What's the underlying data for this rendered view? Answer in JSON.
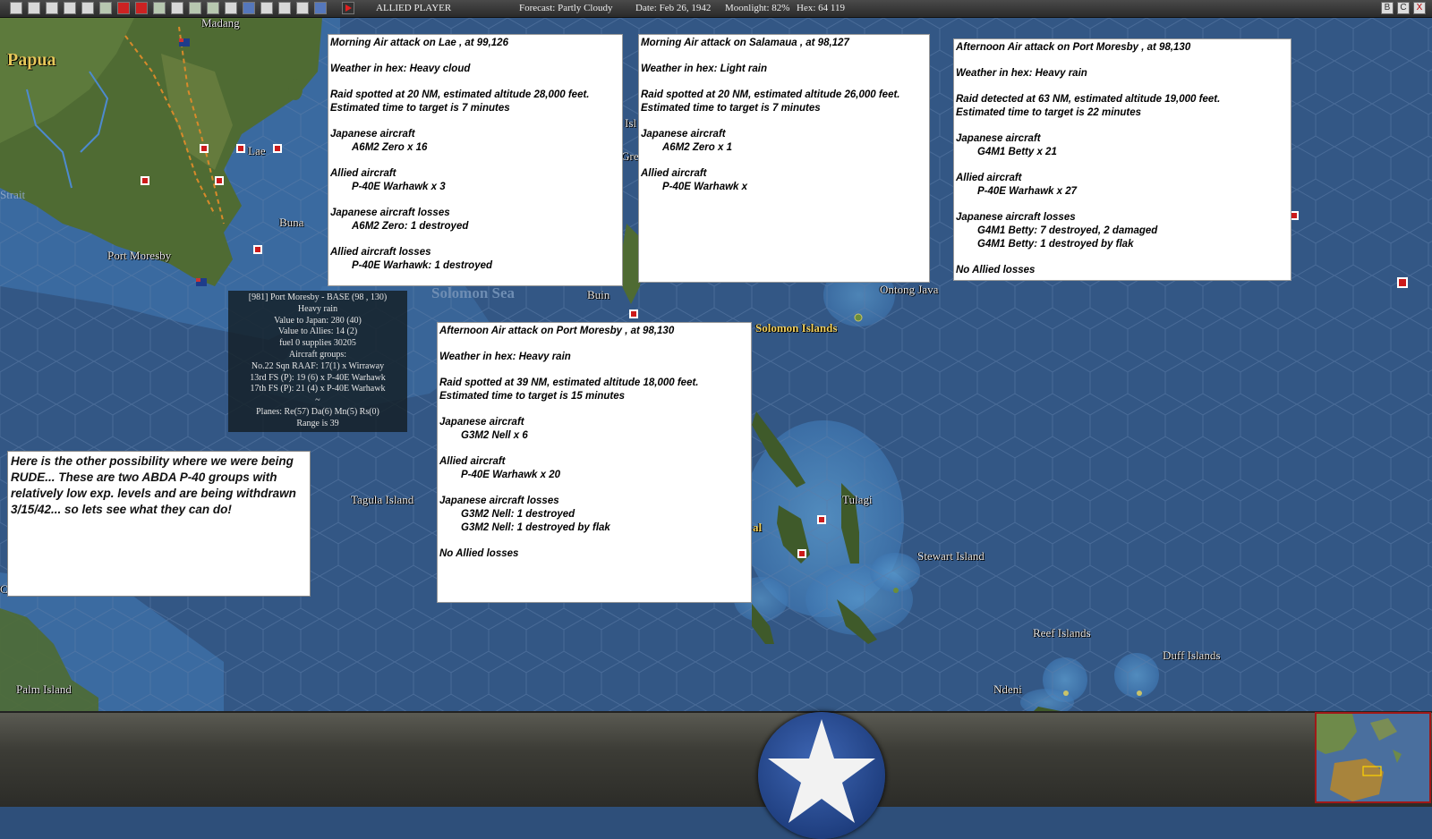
{
  "toolbar": {
    "player": "ALLIED PLAYER",
    "forecast": "Forecast: Partly Cloudy",
    "date": "Date: Feb 26, 1942",
    "moonlight": "Moonlight: 82%",
    "hex": "Hex: 64 119",
    "right_buttons": [
      "B",
      "C",
      "X"
    ]
  },
  "map_labels": {
    "papua": "Papua",
    "madang": "Madang",
    "lae": "Lae",
    "buna": "Buna",
    "port_moresby": "Port Moresby",
    "strait": "Strait",
    "solomon_sea": "Solomon Sea",
    "buin": "Buin",
    "ontong_java": "Ontong Java",
    "solomon_islands": "Solomon Islands",
    "tagula_island": "Tagula Island",
    "tulagi": "Tulagi",
    "stewart_island": "Stewart Island",
    "reef_islands": "Reef Islands",
    "duff_islands": "Duff Islands",
    "ndeni": "Ndeni",
    "palm_island": "Palm Island",
    "cairns": "Cairns",
    "isl_fragment": "Isl",
    "gre_fragment": "Gre",
    "al_fragment": "al"
  },
  "reports": [
    {
      "lines": [
        "Morning Air attack on Lae , at 99,126",
        "",
        "Weather in hex: Heavy cloud",
        "",
        "Raid spotted at 20 NM, estimated altitude 28,000 feet.",
        "Estimated time to target is 7 minutes",
        "",
        "Japanese aircraft",
        ">A6M2 Zero x 16",
        "",
        "Allied aircraft",
        ">P-40E Warhawk x 3",
        "",
        "Japanese aircraft losses",
        ">A6M2 Zero: 1 destroyed",
        "",
        "Allied aircraft losses",
        ">P-40E Warhawk: 1 destroyed"
      ]
    },
    {
      "lines": [
        "Morning Air attack on Salamaua , at 98,127",
        "",
        "Weather in hex: Light rain",
        "",
        "Raid spotted at 20 NM, estimated altitude 26,000 feet.",
        "Estimated time to target is 7 minutes",
        "",
        "Japanese aircraft",
        ">A6M2 Zero x 1",
        "",
        "Allied aircraft",
        ">P-40E Warhawk x"
      ]
    },
    {
      "lines": [
        "Afternoon Air attack on Port Moresby , at 98,130",
        "",
        "Weather in hex: Heavy rain",
        "",
        "Raid detected at 63 NM, estimated altitude 19,000 feet.",
        "Estimated time to target is 22 minutes",
        "",
        "Japanese aircraft",
        ">G4M1 Betty x 21",
        "",
        "Allied aircraft",
        ">P-40E Warhawk x 27",
        "",
        "Japanese aircraft losses",
        ">G4M1 Betty: 7 destroyed, 2 damaged",
        ">G4M1 Betty: 1 destroyed by flak",
        "",
        "No Allied losses"
      ]
    },
    {
      "lines": [
        "Afternoon Air attack on Port Moresby , at 98,130",
        "",
        "Weather in hex: Heavy rain",
        "",
        "Raid spotted at 39 NM, estimated altitude 18,000 feet.",
        "Estimated time to target is 15 minutes",
        "",
        "Japanese aircraft",
        ">G3M2 Nell x 6",
        "",
        "Allied aircraft",
        ">P-40E Warhawk x 20",
        "",
        "Japanese aircraft losses",
        ">G3M2 Nell: 1 destroyed",
        ">G3M2 Nell: 1 destroyed by flak",
        "",
        "No Allied losses"
      ]
    }
  ],
  "base_info": {
    "lines": [
      "[981] Port Moresby - BASE (98 , 130)",
      "Heavy rain",
      "Value to Japan: 280 (40)",
      "Value to Allies: 14 (2)",
      "fuel 0  supplies 30205",
      "Aircraft groups:",
      "No.22 Sqn RAAF: 17(1) x Wirraway",
      "13rd FS (P): 19 (6) x P-40E Warhawk",
      "17th FS (P): 21 (4) x P-40E Warhawk",
      "~",
      "Planes: Re(57) Da(6) Mn(5) Rs(0)",
      "Range is 39"
    ]
  },
  "commentary": "Here is the other possibility where we were being RUDE... These are two ABDA P-40 groups with relatively low exp. levels and are being withdrawn 3/15/42... so lets see what they can do!",
  "colors": {
    "ocean": "#335785",
    "land": "#4f6b33",
    "japan_marker": "#cc1a1a",
    "label_yellow": "#f0d060",
    "roundel_blue": "#1d3c7c"
  },
  "icons": [
    "toolbar-button-icon",
    "play-turn-icon",
    "japanese-base-icon",
    "allied-flag-icon",
    "star-roundel-icon"
  ]
}
